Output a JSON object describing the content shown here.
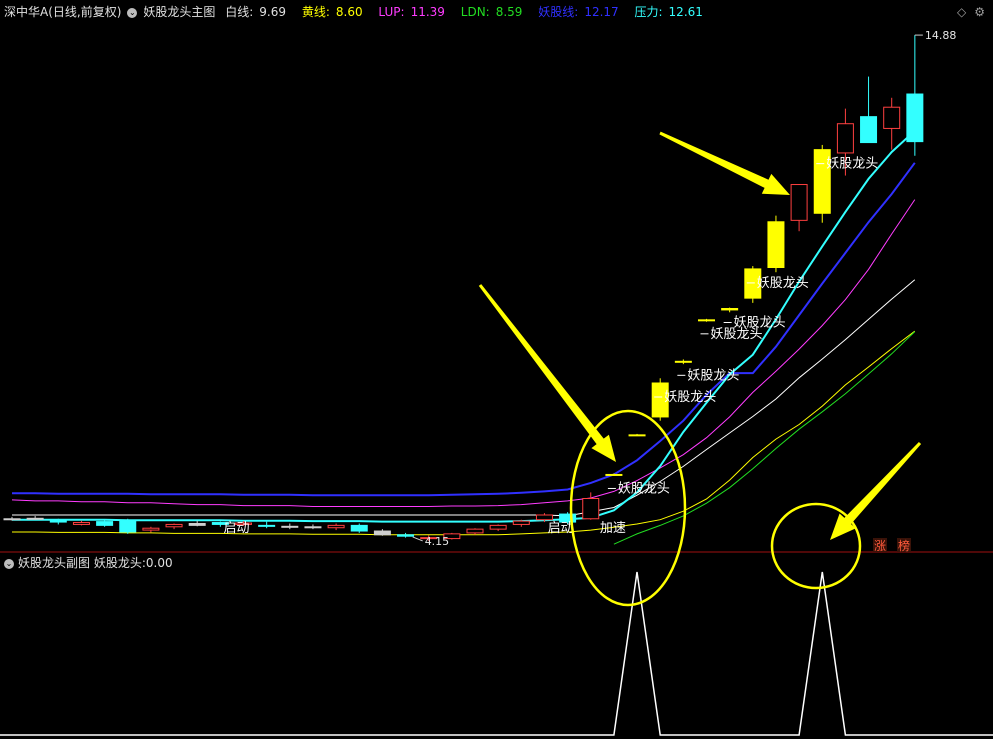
{
  "header": {
    "stock": "深中华A(日线,前复权)",
    "indicator_name": "妖股龙头主图",
    "values": [
      {
        "label": "白线:",
        "value": "9.69",
        "color": "#ffffff"
      },
      {
        "label": "黄线:",
        "value": "8.60",
        "color": "#ffff00"
      },
      {
        "label": "LUP:",
        "value": "11.39",
        "color": "#ff3cff"
      },
      {
        "label": "LDN:",
        "value": "8.59",
        "color": "#22dd22"
      },
      {
        "label": "妖股线:",
        "value": "12.17",
        "color": "#3030ff"
      },
      {
        "label": "压力:",
        "value": "12.61",
        "color": "#33ffff"
      }
    ],
    "icons": [
      "diamond-icon",
      "settings-icon"
    ]
  },
  "sub_header": {
    "indicator_name": "妖股龙头副图",
    "value_label": "妖股龙头:",
    "value": "0.00"
  },
  "colors": {
    "up": "#ff4040",
    "down": "#33ffff",
    "signal": "#ffff00",
    "white_line": "#ffffff",
    "yellow_line": "#ffff00",
    "lup": "#ff3cff",
    "ldn": "#22dd22",
    "demon_line": "#3030ff",
    "pressure": "#33ffff",
    "arrow": "#ffff00",
    "divider": "#a01010"
  },
  "chart_data": {
    "type": "candlestick",
    "price_range": [
      4.0,
      15.2
    ],
    "max_label": "14.88",
    "min_label": "4.15",
    "candles": [
      {
        "o": 4.62,
        "h": 4.66,
        "l": 4.58,
        "c": 4.6
      },
      {
        "o": 4.63,
        "h": 4.68,
        "l": 4.6,
        "c": 4.62
      },
      {
        "o": 4.55,
        "h": 4.62,
        "l": 4.5,
        "c": 4.6
      },
      {
        "o": 4.54,
        "h": 4.58,
        "l": 4.48,
        "c": 4.5
      },
      {
        "o": 4.48,
        "h": 4.6,
        "l": 4.45,
        "c": 4.56
      },
      {
        "o": 4.58,
        "h": 4.62,
        "l": 4.3,
        "c": 4.34
      },
      {
        "o": 4.38,
        "h": 4.45,
        "l": 4.33,
        "c": 4.42
      },
      {
        "o": 4.45,
        "h": 4.52,
        "l": 4.4,
        "c": 4.5
      },
      {
        "o": 4.52,
        "h": 4.58,
        "l": 4.46,
        "c": 4.48
      },
      {
        "o": 4.5,
        "h": 4.56,
        "l": 4.45,
        "c": 4.54
      },
      {
        "o": 4.53,
        "h": 4.57,
        "l": 4.47,
        "c": 4.5
      },
      {
        "o": 4.48,
        "h": 4.56,
        "l": 4.42,
        "c": 4.46
      },
      {
        "o": 4.46,
        "h": 4.52,
        "l": 4.4,
        "c": 4.45
      },
      {
        "o": 4.45,
        "h": 4.5,
        "l": 4.4,
        "c": 4.43
      },
      {
        "o": 4.43,
        "h": 4.52,
        "l": 4.38,
        "c": 4.48
      },
      {
        "o": 4.48,
        "h": 4.52,
        "l": 4.32,
        "c": 4.36
      },
      {
        "o": 4.36,
        "h": 4.4,
        "l": 4.26,
        "c": 4.28
      },
      {
        "o": 4.28,
        "h": 4.32,
        "l": 4.22,
        "c": 4.25
      },
      {
        "o": 4.22,
        "h": 4.27,
        "l": 4.15,
        "c": 4.2
      },
      {
        "o": 4.2,
        "h": 4.32,
        "l": 4.18,
        "c": 4.3
      },
      {
        "o": 4.32,
        "h": 4.42,
        "l": 4.28,
        "c": 4.4
      },
      {
        "o": 4.4,
        "h": 4.5,
        "l": 4.36,
        "c": 4.48
      },
      {
        "o": 4.5,
        "h": 4.6,
        "l": 4.45,
        "c": 4.57
      },
      {
        "o": 4.6,
        "h": 4.74,
        "l": 4.55,
        "c": 4.7
      },
      {
        "o": 4.72,
        "h": 4.76,
        "l": 4.5,
        "c": 4.55
      },
      {
        "o": 4.62,
        "h": 5.18,
        "l": 4.6,
        "c": 5.05
      },
      {
        "o": 5.55,
        "h": 5.58,
        "l": 5.53,
        "c": 5.56
      },
      {
        "o": 6.4,
        "h": 6.42,
        "l": 6.38,
        "c": 6.4
      },
      {
        "o": 6.78,
        "h": 7.6,
        "l": 6.7,
        "c": 7.5
      },
      {
        "o": 7.95,
        "h": 8.0,
        "l": 7.9,
        "c": 7.96
      },
      {
        "o": 8.83,
        "h": 8.86,
        "l": 8.8,
        "c": 8.84
      },
      {
        "o": 9.05,
        "h": 9.1,
        "l": 9.0,
        "c": 9.08
      },
      {
        "o": 9.3,
        "h": 9.98,
        "l": 9.2,
        "c": 9.92
      },
      {
        "o": 9.95,
        "h": 11.05,
        "l": 9.85,
        "c": 10.92
      },
      {
        "o": 10.95,
        "h": 11.72,
        "l": 10.72,
        "c": 11.71
      },
      {
        "o": 11.1,
        "h": 12.55,
        "l": 10.9,
        "c": 12.45
      },
      {
        "o": 12.38,
        "h": 13.32,
        "l": 11.9,
        "c": 13.0
      },
      {
        "o": 13.15,
        "h": 14.0,
        "l": 12.7,
        "c": 12.6
      },
      {
        "o": 12.9,
        "h": 13.55,
        "l": 12.45,
        "c": 13.35
      },
      {
        "o": 13.63,
        "h": 14.88,
        "l": 12.32,
        "c": 12.62
      }
    ],
    "styles": [
      "cross",
      "cross",
      "down",
      "up",
      "down",
      "down",
      "up",
      "up",
      "cross",
      "down",
      "up",
      "down",
      "cross",
      "cross",
      "up",
      "down",
      "cross",
      "down",
      "up",
      "up",
      "up",
      "up",
      "up",
      "up",
      "down",
      "up",
      "signal",
      "signal",
      "signal",
      "signal",
      "signal",
      "signal",
      "signal",
      "signal",
      "up",
      "signal",
      "up",
      "down",
      "up",
      "down"
    ],
    "lines": {
      "white": [
        4.7,
        4.7,
        4.7,
        4.7,
        4.7,
        4.7,
        4.7,
        4.7,
        4.7,
        4.7,
        4.7,
        4.7,
        4.7,
        4.7,
        4.7,
        4.7,
        4.7,
        4.7,
        4.7,
        4.7,
        4.7,
        4.7,
        4.7,
        4.7,
        4.68,
        4.77,
        4.86,
        5.12,
        5.41,
        5.73,
        6.09,
        6.44,
        6.79,
        7.16,
        7.61,
        8.01,
        8.42,
        8.85,
        9.28,
        9.69
      ],
      "yellow": [
        4.34,
        4.34,
        4.33,
        4.33,
        4.33,
        4.32,
        4.32,
        4.31,
        4.31,
        4.31,
        4.3,
        4.3,
        4.3,
        4.29,
        4.29,
        4.29,
        4.28,
        4.28,
        4.28,
        4.28,
        4.28,
        4.28,
        4.3,
        4.32,
        4.34,
        4.38,
        4.44,
        4.51,
        4.6,
        4.78,
        5.04,
        5.44,
        5.92,
        6.31,
        6.62,
        7.01,
        7.46,
        7.84,
        8.23,
        8.6
      ],
      "lup": [
        5.02,
        5.0,
        5.0,
        4.98,
        4.98,
        4.96,
        4.96,
        4.94,
        4.92,
        4.92,
        4.9,
        4.9,
        4.9,
        4.88,
        4.88,
        4.88,
        4.88,
        4.88,
        4.88,
        4.89,
        4.89,
        4.9,
        4.92,
        4.96,
        5.0,
        5.06,
        5.2,
        5.43,
        5.7,
        5.98,
        6.34,
        6.78,
        7.3,
        7.75,
        8.22,
        8.72,
        9.27,
        9.91,
        10.66,
        11.39
      ],
      "ldn": [
        null,
        null,
        null,
        null,
        null,
        null,
        null,
        null,
        null,
        null,
        null,
        null,
        null,
        null,
        null,
        null,
        null,
        null,
        null,
        null,
        null,
        null,
        null,
        null,
        null,
        null,
        4.08,
        4.3,
        4.48,
        4.68,
        4.95,
        5.28,
        5.68,
        6.11,
        6.52,
        6.89,
        7.27,
        7.69,
        8.12,
        8.59
      ],
      "demon": [
        5.16,
        5.16,
        5.15,
        5.15,
        5.15,
        5.15,
        5.14,
        5.14,
        5.14,
        5.14,
        5.13,
        5.13,
        5.13,
        5.12,
        5.12,
        5.12,
        5.12,
        5.12,
        5.12,
        5.13,
        5.14,
        5.15,
        5.17,
        5.2,
        5.24,
        5.38,
        5.56,
        5.86,
        6.27,
        6.7,
        7.25,
        7.71,
        7.71,
        8.27,
        8.94,
        9.61,
        10.26,
        10.91,
        11.51,
        12.17
      ],
      "pressure": [
        4.6,
        4.6,
        4.6,
        4.6,
        4.6,
        4.59,
        4.59,
        4.59,
        4.59,
        4.59,
        4.58,
        4.58,
        4.58,
        4.57,
        4.57,
        4.57,
        4.56,
        4.56,
        4.56,
        4.56,
        4.56,
        4.56,
        4.57,
        4.59,
        4.61,
        4.64,
        4.8,
        5.18,
        5.74,
        6.46,
        7.08,
        7.68,
        8.1,
        8.85,
        9.65,
        10.4,
        11.13,
        11.83,
        12.4,
        12.85
      ]
    },
    "labels": [
      {
        "i": 10,
        "text": "启动"
      },
      {
        "i": 24,
        "text": "启动"
      },
      {
        "i": 26,
        "text": "妖股龙头"
      },
      {
        "i": 26,
        "text": "加速"
      },
      {
        "i": 28,
        "text": "妖股龙头"
      },
      {
        "i": 29,
        "text": "妖股龙头"
      },
      {
        "i": 30,
        "text": "妖股龙头"
      },
      {
        "i": 31,
        "text": "妖股龙头"
      },
      {
        "i": 32,
        "text": "妖股龙头"
      },
      {
        "i": 35,
        "text": "妖股龙头"
      }
    ],
    "badges": [
      "涨",
      "榜"
    ],
    "sub_values": [
      0,
      0,
      0,
      0,
      0,
      0,
      0,
      0,
      0,
      0,
      0,
      0,
      0,
      0,
      0,
      0,
      0,
      0,
      0,
      0,
      0,
      0,
      0,
      0,
      0,
      0,
      0,
      1,
      0,
      0,
      0,
      0,
      0,
      0,
      0,
      1,
      0,
      0,
      0,
      0
    ]
  }
}
